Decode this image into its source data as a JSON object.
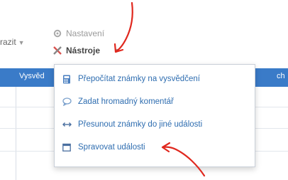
{
  "toolbar": {
    "zobrazit_label": "razit",
    "settings_label": "Nastavení",
    "tools_label": "Nástroje"
  },
  "table": {
    "header_label": "Vysvěd",
    "header_right": "ch"
  },
  "tools_menu": {
    "items": [
      {
        "label": "Přepočítat známky na vysvědčení",
        "icon": "calculator-icon"
      },
      {
        "label": "Zadat hromadný komentář",
        "icon": "comment-icon"
      },
      {
        "label": "Přesunout známky do jiné události",
        "icon": "move-arrows-icon"
      },
      {
        "label": "Spravovat události",
        "icon": "calendar-icon"
      }
    ]
  },
  "colors": {
    "accent": "#3a7bc8",
    "menu_text": "#2e6db0",
    "annotation_arrow": "#e0281e"
  }
}
